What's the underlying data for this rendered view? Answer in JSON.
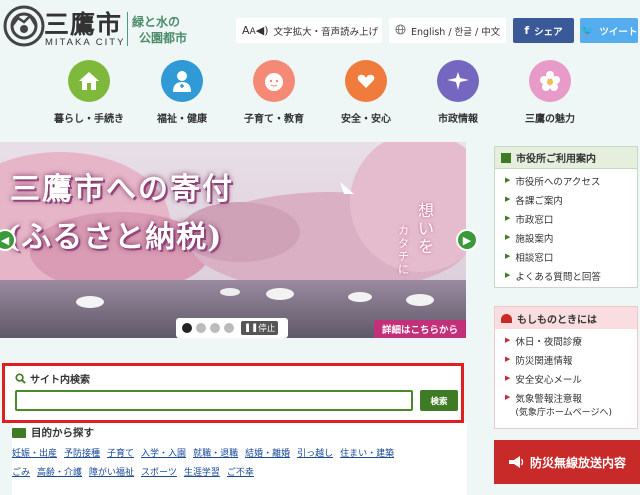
{
  "header": {
    "logo_jp": "三鷹市",
    "logo_en": "MITAKA CITY",
    "tagline_1": "緑と水の",
    "tagline_2": "公園都市",
    "text_tools_label": "文字拡大・音声読み上げ",
    "language_label": "English / 한글 / 中文",
    "facebook_label": "シェア",
    "twitter_label": "ツイート"
  },
  "nav": {
    "items": [
      {
        "label": "暮らし・手続き",
        "icon": "house-icon",
        "color": "#7fb93c"
      },
      {
        "label": "福祉・健康",
        "icon": "person-icon",
        "color": "#2f9ad6"
      },
      {
        "label": "子育て・教育",
        "icon": "child-face-icon",
        "color": "#f48a76"
      },
      {
        "label": "安全・安心",
        "icon": "heart-hands-icon",
        "color": "#ef7c3c"
      },
      {
        "label": "市政情報",
        "icon": "bird-icon",
        "color": "#7567c0"
      },
      {
        "label": "三鷹の魅力",
        "icon": "flower-icon",
        "color": "#e89ac9"
      }
    ]
  },
  "hero": {
    "title": "三鷹市への寄付",
    "subtitle": "(ふるさと納税)",
    "vertical_1": "想いを",
    "vertical_2": "カタチに",
    "pause_label": "停止",
    "detail_label": "詳細はこちらから",
    "slide_count": 4,
    "active_slide": 1
  },
  "search": {
    "title": "サイト内検索",
    "input_value": "",
    "placeholder": "",
    "button_label": "検索"
  },
  "purpose": {
    "title": "目的から探す",
    "row1": [
      "妊娠・出産",
      "予防接種",
      "子育て",
      "入学・入園",
      "就職・退職",
      "結婚・離婚",
      "引っ越し",
      "住まい・建築"
    ],
    "row2": [
      "ごみ",
      "高齢・介護",
      "障がい福祉",
      "スポーツ",
      "生涯学習",
      "ご不幸"
    ]
  },
  "office": {
    "title": "市役所ご利用案内",
    "items": [
      "市役所へのアクセス",
      "各課ご案内",
      "市政窓口",
      "施設案内",
      "相談窓口",
      "よくある質問と回答"
    ]
  },
  "emergency": {
    "title": "もしものときには",
    "items": [
      "休日・夜間診療",
      "防災関連情報",
      "安全安心メール",
      "気象警報注意報"
    ],
    "note": "(気象庁ホームページへ)"
  },
  "bousai": {
    "label": "防災無線放送内容"
  },
  "colors": {
    "accent_green": "#3f7a25",
    "search_border": "#e02020",
    "emergency_red": "#c82a2a",
    "facebook": "#3b5998",
    "twitter": "#55acee"
  }
}
